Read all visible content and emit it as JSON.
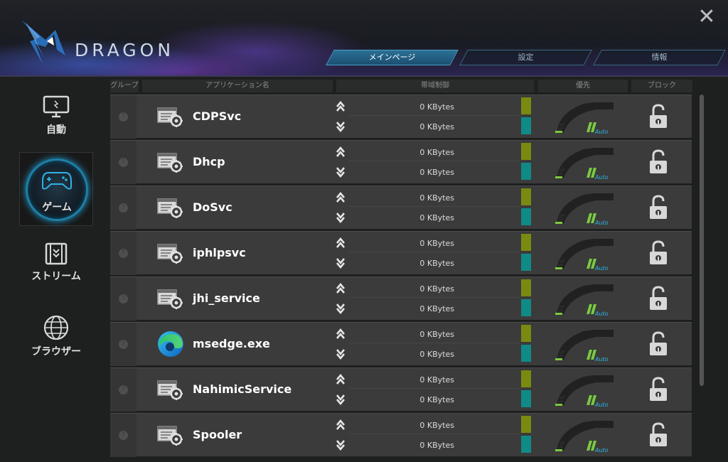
{
  "app": {
    "brand": "DRAGON"
  },
  "nav_tabs": [
    {
      "label": "メインページ",
      "active": true
    },
    {
      "label": "設定",
      "active": false
    },
    {
      "label": "情報",
      "active": false
    }
  ],
  "sidebar": {
    "items": [
      {
        "label": "自動",
        "icon": "monitor-icon",
        "active": false
      },
      {
        "label": "ゲーム",
        "icon": "gamepad-icon",
        "active": true
      },
      {
        "label": "ストリーム",
        "icon": "film-icon",
        "active": false
      },
      {
        "label": "ブラウザー",
        "icon": "globe-icon",
        "active": false
      }
    ]
  },
  "columns": {
    "group": "グループ",
    "app": "アプリケーション名",
    "bandwidth": "帯域制御",
    "priority": "優先",
    "block": "ブロック"
  },
  "rows": [
    {
      "name": "CDPSvc",
      "icon": "service-gear-icon",
      "up": "0 KBytes",
      "down": "0 KBytes",
      "priority": "Auto"
    },
    {
      "name": "Dhcp",
      "icon": "service-gear-icon",
      "up": "0 KBytes",
      "down": "0 KBytes",
      "priority": "Auto"
    },
    {
      "name": "DoSvc",
      "icon": "service-gear-icon",
      "up": "0 KBytes",
      "down": "0 KBytes",
      "priority": "Auto"
    },
    {
      "name": "iphlpsvc",
      "icon": "service-gear-icon",
      "up": "0 KBytes",
      "down": "0 KBytes",
      "priority": "Auto"
    },
    {
      "name": "jhi_service",
      "icon": "service-gear-icon",
      "up": "0 KBytes",
      "down": "0 KBytes",
      "priority": "Auto"
    },
    {
      "name": "msedge.exe",
      "icon": "edge-icon",
      "up": "0 KBytes",
      "down": "0 KBytes",
      "priority": "Auto"
    },
    {
      "name": "NahimicService",
      "icon": "service-gear-icon",
      "up": "0 KBytes",
      "down": "0 KBytes",
      "priority": "Auto"
    },
    {
      "name": "Spooler",
      "icon": "service-gear-icon",
      "up": "0 KBytes",
      "down": "0 KBytes",
      "priority": "Auto"
    }
  ],
  "colors": {
    "upload_bar": "#7a8a10",
    "download_bar": "#108a86",
    "accent": "#1f9fd0",
    "priority_green": "#7ac943"
  }
}
